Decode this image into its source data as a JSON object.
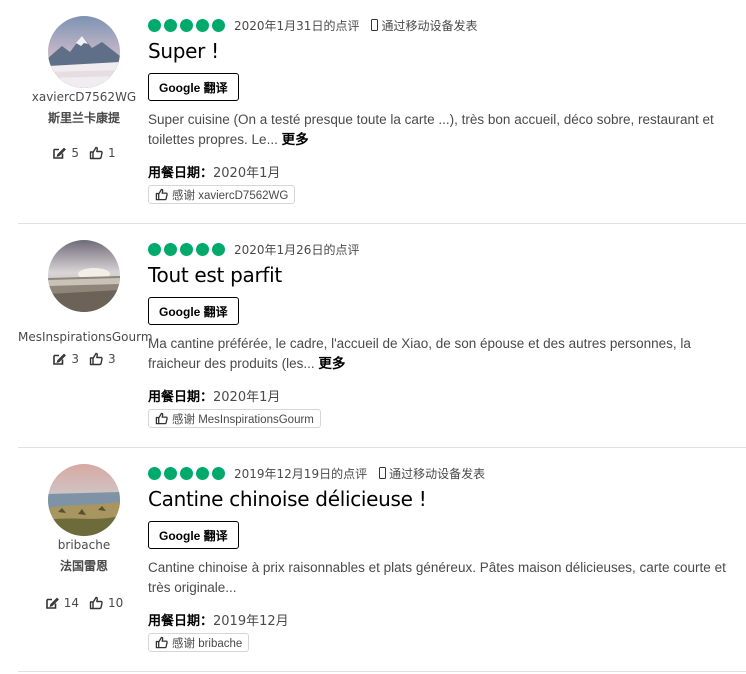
{
  "icons": {
    "rating": "green-bubble-icon",
    "mobile": "mobile-phone-icon",
    "review_count": "pencil-edit-icon",
    "helpful": "thumbs-up-icon",
    "thanks": "thumbs-up-icon"
  },
  "colors": {
    "bubble": "#00aa6c",
    "separator": "#e0e0e0"
  },
  "reviews": [
    {
      "username": "xaviercD7562WG",
      "location": "斯里兰卡康提",
      "review_count": "5",
      "helpful_count": "1",
      "rating": 5,
      "date": "2020年1月31日的点评",
      "mobile_label": "通过移动设备发表",
      "title": "Super !",
      "translate_label": "Google 翻译",
      "text": "Super cuisine (On a testé presque toute la carte ...), très bon accueil, déco sobre, restaurant et toilettes propres. Le...",
      "more_label": "更多",
      "dine_label": "用餐日期：",
      "dine_date": "2020年1月",
      "thanks_label": "感谢 xaviercD7562WG"
    },
    {
      "username": "MesInspirationsGourm",
      "location": "",
      "review_count": "3",
      "helpful_count": "3",
      "rating": 5,
      "date": "2020年1月26日的点评",
      "mobile_label": "",
      "title": "Tout est parfit",
      "translate_label": "Google 翻译",
      "text": "Ma cantine préférée, le cadre, l'accueil de Xiao, de son épouse et des autres personnes, la fraicheur des produits (les...",
      "more_label": "更多",
      "dine_label": "用餐日期：",
      "dine_date": "2020年1月",
      "thanks_label": "感谢 MesInspirationsGourm"
    },
    {
      "username": "bribache",
      "location": "法国雷恩",
      "review_count": "14",
      "helpful_count": "10",
      "rating": 5,
      "date": "2019年12月19日的点评",
      "mobile_label": "通过移动设备发表",
      "title": "Cantine chinoise délicieuse !",
      "translate_label": "Google 翻译",
      "text": "Cantine chinoise à prix raisonnables et plats généreux. Pâtes maison délicieuses, carte courte et très originale...",
      "more_label": "",
      "dine_label": "用餐日期：",
      "dine_date": "2019年12月",
      "thanks_label": "感谢 bribache"
    }
  ]
}
